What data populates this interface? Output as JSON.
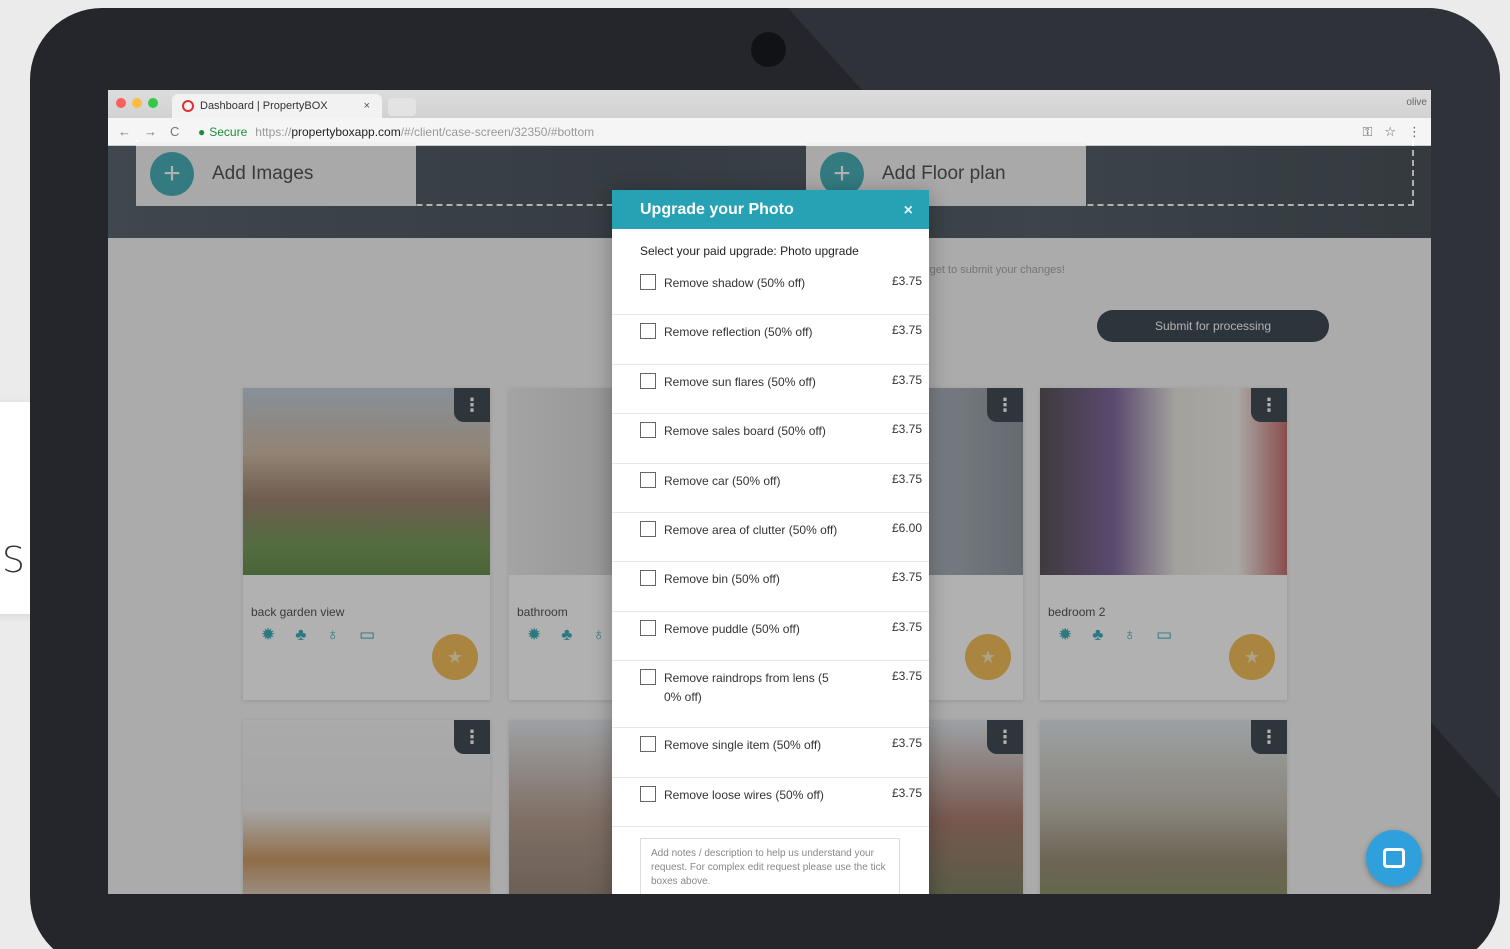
{
  "side_card": {
    "letter": "S"
  },
  "browser": {
    "tab_title": "Dashboard | PropertyBOX",
    "tab_close": "×",
    "user": "olive",
    "secure_label": "Secure",
    "url_scheme": "https://",
    "url_host": "propertyboxapp.com",
    "url_path": "/#/client/case-screen/32350/#bottom"
  },
  "page": {
    "add_images": "Add Images",
    "add_floor_plan": "Add Floor plan",
    "hint": "rget to submit your changes!",
    "submit_button": "Submit for processing",
    "cards": [
      {
        "name": "back garden view"
      },
      {
        "name": "bathroom"
      },
      {
        "name": ""
      },
      {
        "name": "bedroom 2"
      }
    ]
  },
  "modal": {
    "title": "Upgrade your Photo",
    "close": "×",
    "subtitle": "Select your paid upgrade: Photo upgrade",
    "options": [
      {
        "label": "Remove shadow (50% off)",
        "price": "£3.75"
      },
      {
        "label": "Remove reflection (50% off)",
        "price": "£3.75"
      },
      {
        "label": "Remove sun flares (50% off)",
        "price": "£3.75"
      },
      {
        "label": "Remove sales board (50% off)",
        "price": "£3.75"
      },
      {
        "label": "Remove car (50% off)",
        "price": "£3.75"
      },
      {
        "label": "Remove area of clutter (50% off)",
        "price": "£6.00"
      },
      {
        "label": "Remove bin (50% off)",
        "price": "£3.75"
      },
      {
        "label": "Remove puddle (50% off)",
        "price": "£3.75"
      },
      {
        "label": "Remove raindrops from lens (5 0% off)",
        "price": "£3.75"
      },
      {
        "label": "Remove single item (50% off)",
        "price": "£3.75"
      },
      {
        "label": "Remove loose wires (50% off)",
        "price": "£3.75"
      }
    ],
    "notes_placeholder": "Add notes / description to help us understand your request. For complex edit request please use the tick boxes above."
  },
  "colors": {
    "accent": "#27a2b5",
    "dark_navy": "#1c2a36",
    "star_badge": "#f2b33d",
    "chat_button": "#2fa0dc"
  },
  "icons": {
    "card_icons": [
      "sun-icon",
      "palette-icon",
      "drop-icon",
      "image-icon"
    ],
    "star": "star-icon",
    "menu": "vertical-dots-icon"
  }
}
